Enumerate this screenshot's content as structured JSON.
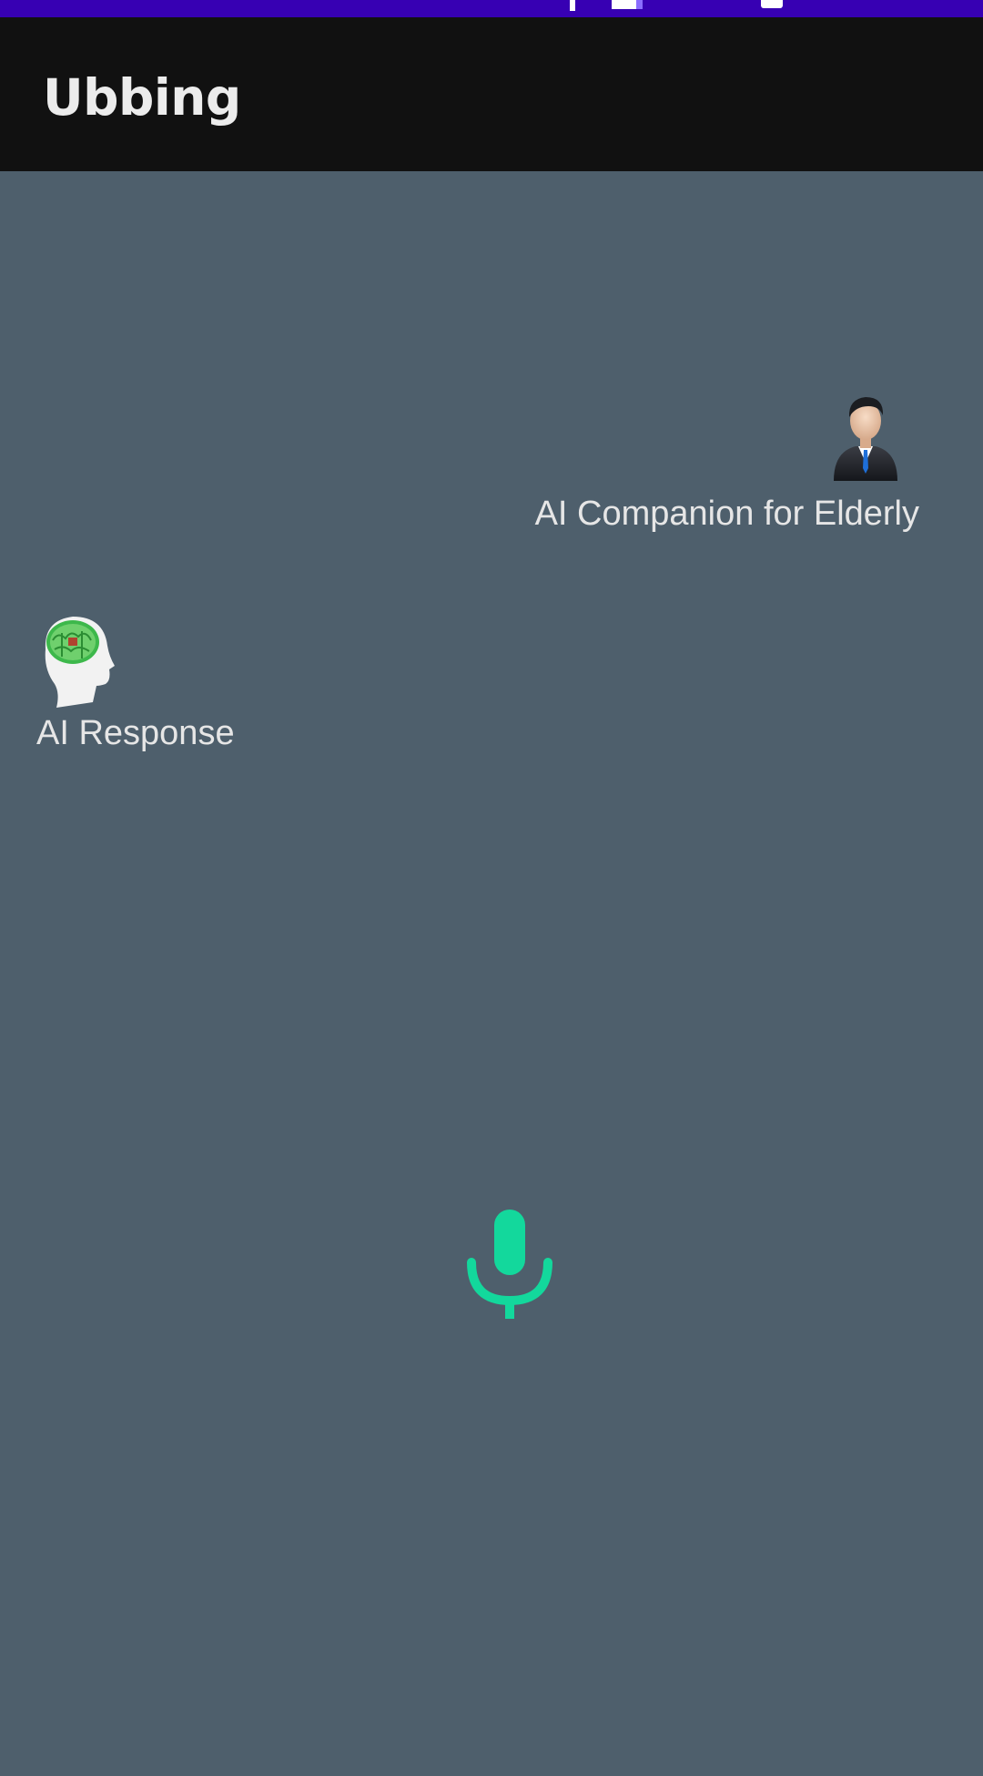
{
  "app": {
    "title": "Ubbing"
  },
  "conversation": {
    "user_message": {
      "text": "AI Companion for Elderly",
      "avatar_icon": "businessman-avatar-icon"
    },
    "ai_message": {
      "text": "AI Response",
      "avatar_icon": "ai-brain-head-icon"
    }
  },
  "controls": {
    "mic_icon": "microphone-icon",
    "mic_color": "#13d89c"
  },
  "theme": {
    "status_bar_color": "#3700b3",
    "app_bar_color": "#111111",
    "background_color": "#4e5f6c",
    "text_color": "#e6e6e6"
  }
}
